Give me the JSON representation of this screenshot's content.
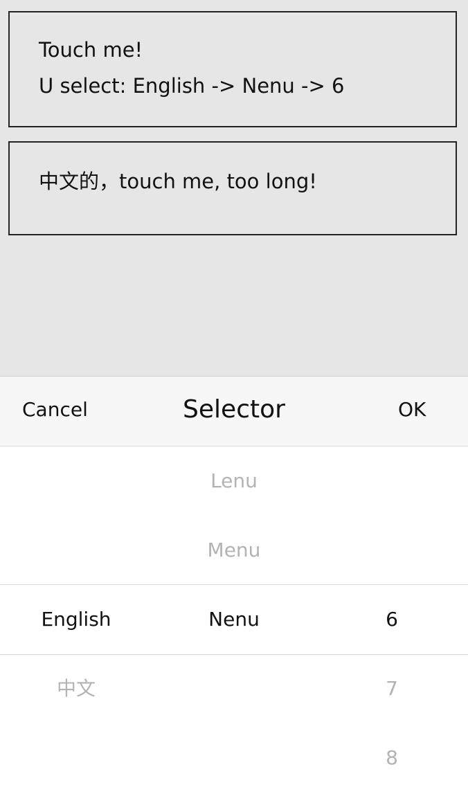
{
  "cards": [
    {
      "lines": [
        "Touch me!",
        "U select: English -> Nenu -> 6"
      ]
    },
    {
      "lines": [
        "中文的，touch me, too long!"
      ]
    }
  ],
  "picker": {
    "cancel_label": "Cancel",
    "title": "Selector",
    "ok_label": "OK",
    "columns": {
      "language": {
        "items": [
          "English",
          "中文"
        ],
        "selected": "English"
      },
      "menu": {
        "items": [
          "Lenu",
          "Menu",
          "Nenu"
        ],
        "selected": "Nenu"
      },
      "number": {
        "items": [
          "6",
          "7",
          "8"
        ],
        "selected": "6"
      }
    }
  },
  "colors": {
    "background": "#e6e6e6",
    "sheet": "#ffffff",
    "toolbar": "#f7f7f7",
    "text": "#111111",
    "faded_text": "#b3b3b3",
    "divider": "#d9d9d9"
  }
}
